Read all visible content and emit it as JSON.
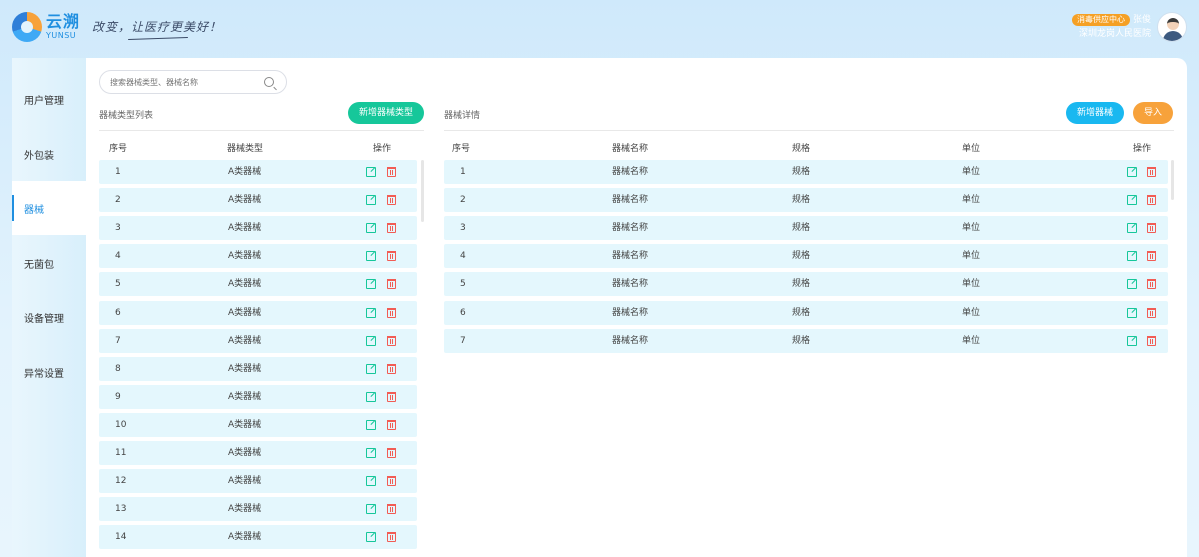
{
  "header": {
    "logo_cn": "云溯",
    "logo_en": "YUNSU",
    "slogan": "改变，让医疗更美好！",
    "role": "消毒供应中心",
    "user_name": "张俊",
    "hospital": "深圳龙岗人民医院"
  },
  "sidebar": {
    "items": [
      {
        "label": "用户管理",
        "active": false
      },
      {
        "label": "外包装",
        "active": false
      },
      {
        "label": "器械",
        "active": true
      },
      {
        "label": "无菌包",
        "active": false
      },
      {
        "label": "设备管理",
        "active": false
      },
      {
        "label": "异常设置",
        "active": false
      }
    ]
  },
  "search": {
    "placeholder": "搜索器械类型、器械名称"
  },
  "left_panel": {
    "title": "器械类型列表",
    "add_button": "新增器械类型",
    "columns": [
      "序号",
      "器械类型",
      "操作"
    ],
    "rows": [
      {
        "index": "1",
        "type": "A类器械"
      },
      {
        "index": "2",
        "type": "A类器械"
      },
      {
        "index": "3",
        "type": "A类器械"
      },
      {
        "index": "4",
        "type": "A类器械"
      },
      {
        "index": "5",
        "type": "A类器械"
      },
      {
        "index": "6",
        "type": "A类器械"
      },
      {
        "index": "7",
        "type": "A类器械"
      },
      {
        "index": "8",
        "type": "A类器械"
      },
      {
        "index": "9",
        "type": "A类器械"
      },
      {
        "index": "10",
        "type": "A类器械"
      },
      {
        "index": "11",
        "type": "A类器械"
      },
      {
        "index": "12",
        "type": "A类器械"
      },
      {
        "index": "13",
        "type": "A类器械"
      },
      {
        "index": "14",
        "type": "A类器械"
      }
    ]
  },
  "right_panel": {
    "title": "器械详情",
    "add_button": "新增器械",
    "import_button": "导入",
    "columns": [
      "序号",
      "器械名称",
      "规格",
      "单位",
      "操作"
    ],
    "rows": [
      {
        "index": "1",
        "name": "器械名称",
        "spec": "规格",
        "unit": "单位"
      },
      {
        "index": "2",
        "name": "器械名称",
        "spec": "规格",
        "unit": "单位"
      },
      {
        "index": "3",
        "name": "器械名称",
        "spec": "规格",
        "unit": "单位"
      },
      {
        "index": "4",
        "name": "器械名称",
        "spec": "规格",
        "unit": "单位"
      },
      {
        "index": "5",
        "name": "器械名称",
        "spec": "规格",
        "unit": "单位"
      },
      {
        "index": "6",
        "name": "器械名称",
        "spec": "规格",
        "unit": "单位"
      },
      {
        "index": "7",
        "name": "器械名称",
        "spec": "规格",
        "unit": "单位"
      }
    ]
  },
  "colors": {
    "primary": "#1f8fe0",
    "green": "#16c79a",
    "blue": "#19b8f0",
    "orange": "#f7a23b",
    "row_bg": "#e4f7fd",
    "danger": "#f25c54"
  }
}
